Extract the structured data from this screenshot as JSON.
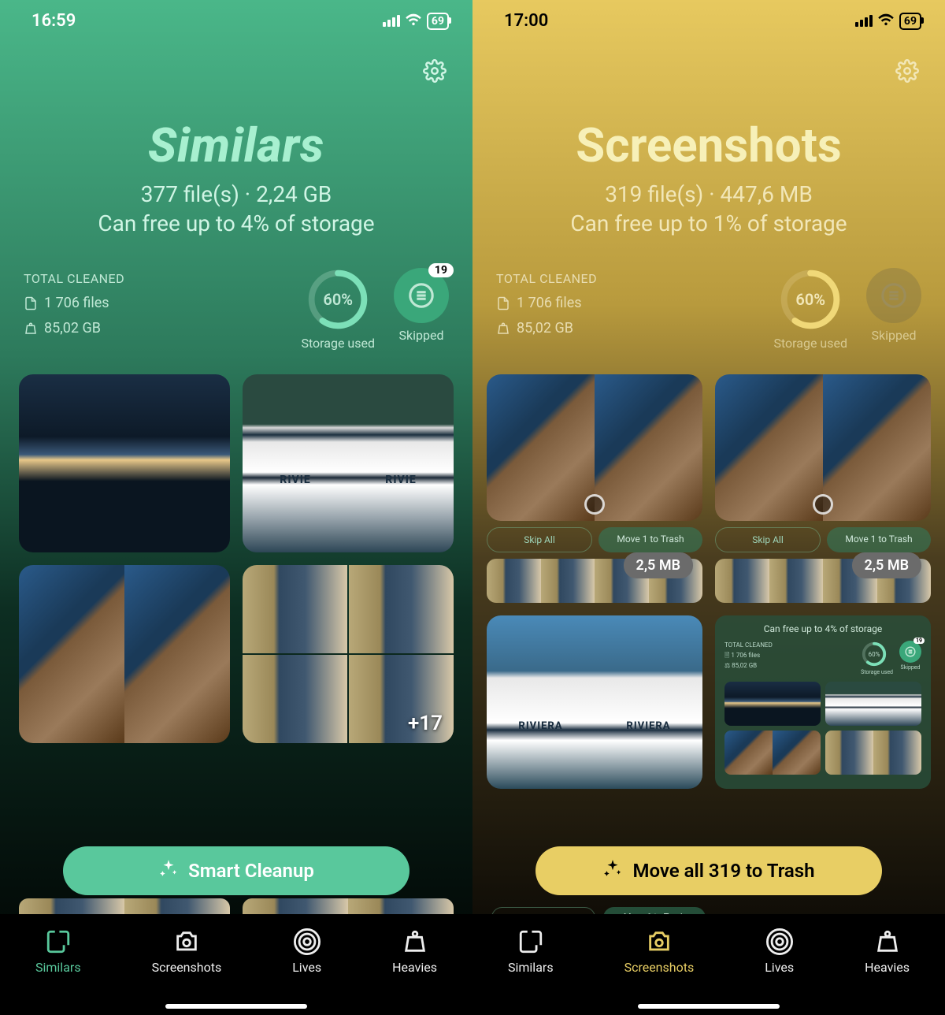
{
  "left": {
    "status": {
      "time": "16:59",
      "battery": "69"
    },
    "title": "Similars",
    "subtitle1": "377 file(s) · 2,24 GB",
    "subtitle2": "Can free up to 4% of storage",
    "total_cleaned": {
      "label": "TOTAL CLEANED",
      "files": "1 706 files",
      "size": "85,02 GB"
    },
    "storage_ring": {
      "percent": 60,
      "text": "60%",
      "label": "Storage used"
    },
    "skipped": {
      "label": "Skipped",
      "badge": "19"
    },
    "grid_more": "+17",
    "cta": "Smart Cleanup",
    "tabs": [
      "Similars",
      "Screenshots",
      "Lives",
      "Heavies"
    ],
    "active_tab": 0
  },
  "right": {
    "status": {
      "time": "17:00",
      "battery": "69"
    },
    "title": "Screenshots",
    "subtitle1": "319 file(s) · 447,6 MB",
    "subtitle2": "Can free up to 1% of storage",
    "total_cleaned": {
      "label": "TOTAL CLEANED",
      "files": "1 706 files",
      "size": "85,02 GB"
    },
    "storage_ring": {
      "percent": 60,
      "text": "60%",
      "label": "Storage used"
    },
    "skipped": {
      "label": "Skipped"
    },
    "actions": {
      "skip_all": "Skip All",
      "move_one": "Move 1 to Trash"
    },
    "size_badge": "2,5 MB",
    "mini": {
      "top": "Can free up to 4% of storage",
      "tc_label": "TOTAL CLEANED",
      "files": "1 706 files",
      "size": "85,02 GB",
      "ring_text": "60%",
      "storage_label": "Storage used",
      "skipped_label": "Skipped",
      "skipped_badge": "19"
    },
    "riviera_label": "RIVIERA",
    "cta": "Move all 319 to Trash",
    "tabs": [
      "Similars",
      "Screenshots",
      "Lives",
      "Heavies"
    ],
    "active_tab": 1
  }
}
